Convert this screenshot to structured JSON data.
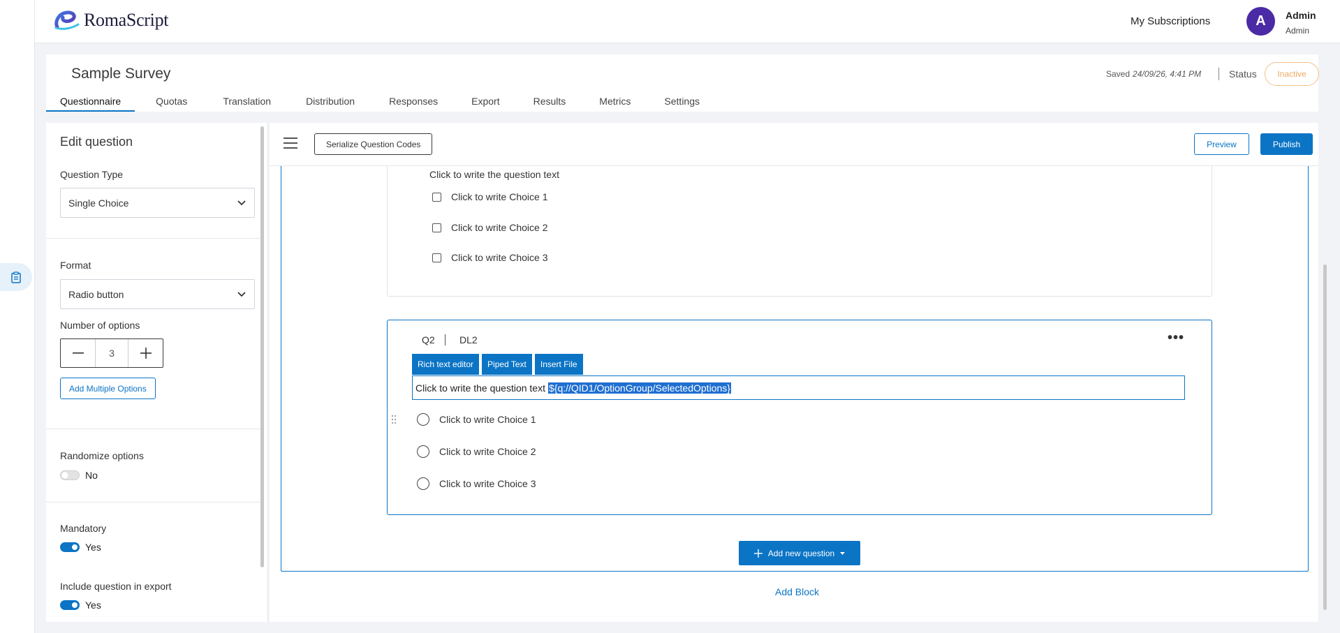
{
  "app": {
    "logo_text": "RomaScript"
  },
  "topbar": {
    "subscriptions_link": "My Subscriptions",
    "avatar_initial": "A",
    "user_name": "Admin",
    "user_role": "Admin"
  },
  "survey": {
    "title": "Sample Survey",
    "saved_label": "Saved",
    "saved_time": "24/09/26, 4:41 PM",
    "status_label": "Status",
    "status_value": "Inactive",
    "status_color": "#f0a860"
  },
  "tabs": [
    {
      "label": "Questionnaire",
      "active": true
    },
    {
      "label": "Quotas"
    },
    {
      "label": "Translation"
    },
    {
      "label": "Distribution"
    },
    {
      "label": "Responses"
    },
    {
      "label": "Export"
    },
    {
      "label": "Results"
    },
    {
      "label": "Metrics"
    },
    {
      "label": "Settings"
    }
  ],
  "editor": {
    "title": "Edit question",
    "question_type_label": "Question Type",
    "question_type_value": "Single Choice",
    "format_label": "Format",
    "format_value": "Radio button",
    "num_options_label": "Number of options",
    "num_options_value": "3",
    "add_multiple_label": "Add Multiple Options",
    "randomize_label": "Randomize options",
    "randomize_value": "No",
    "mandatory_label": "Mandatory",
    "mandatory_value": "Yes",
    "include_export_label": "Include question in export",
    "include_export_value": "Yes"
  },
  "toolbar": {
    "serialize_label": "Serialize Question Codes",
    "preview_label": "Preview",
    "publish_label": "Publish"
  },
  "q1": {
    "question_text": "Click to write the question text",
    "choices": [
      "Click to write Choice 1",
      "Click to write Choice 2",
      "Click to write Choice 3"
    ]
  },
  "q2": {
    "id": "Q2",
    "display_logic": "DL2",
    "more_icon": "more-horizontal-icon",
    "rte_buttons": [
      "Rich text editor",
      "Piped Text",
      "Insert File"
    ],
    "question_text": "Click to write the question text",
    "piped_text": "${q://QID1/OptionGroup/SelectedOptions}",
    "choices": [
      "Click to write Choice 1",
      "Click to write Choice 2",
      "Click to write Choice 3"
    ]
  },
  "add_question_label": "Add new question",
  "add_block_label": "Add Block",
  "accent_color": "#0b74c5"
}
